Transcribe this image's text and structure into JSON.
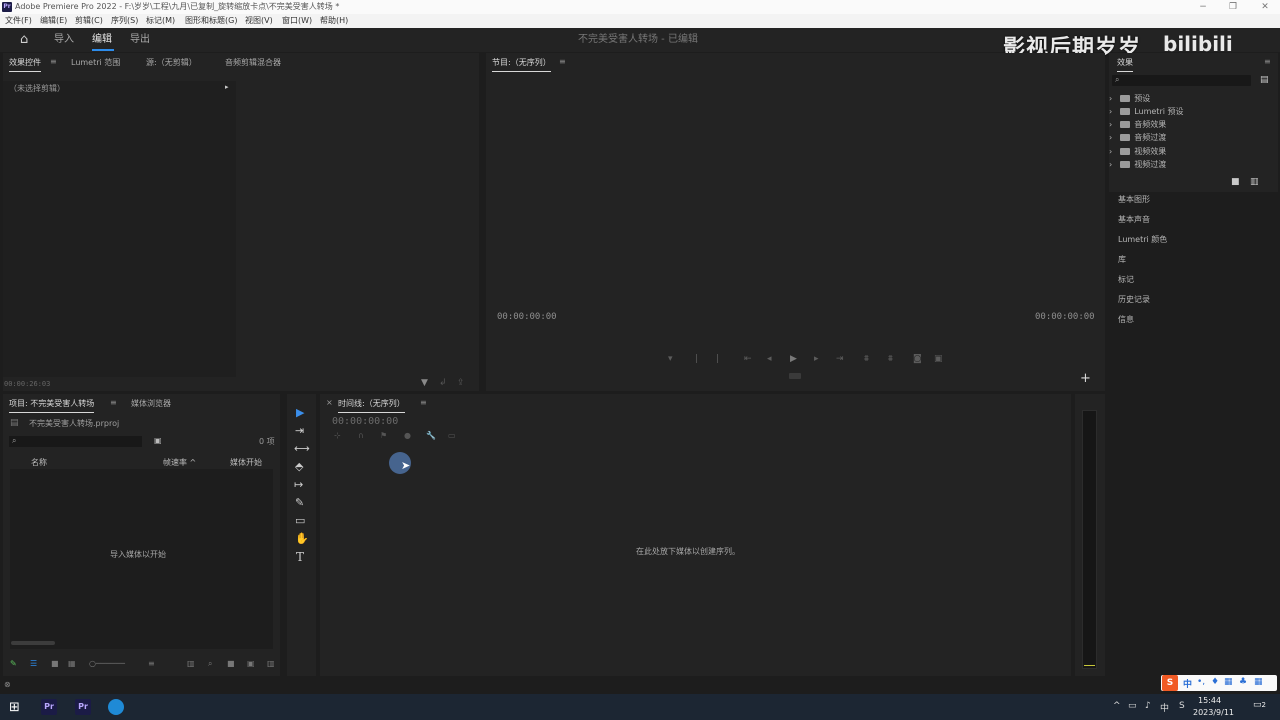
{
  "window": {
    "title": "Adobe Premiere Pro 2022 - F:\\岁岁\\工程\\九月\\已复制_旋转缩放卡点\\不完美受害人转场 *",
    "minimize": "−",
    "maximize": "❐",
    "close": "✕"
  },
  "menu": [
    "文件(F)",
    "编辑(E)",
    "剪辑(C)",
    "序列(S)",
    "标记(M)",
    "图形和标题(G)",
    "视图(V)",
    "窗口(W)",
    "帮助(H)"
  ],
  "header": {
    "home_icon": "⌂",
    "nav": [
      "导入",
      "编辑",
      "导出"
    ],
    "active_nav": "编辑",
    "project_status": "不完美受害人转场 - 已编辑"
  },
  "watermark": {
    "channel": "影视后期岁岁",
    "platform": "bilibili"
  },
  "effect_controls": {
    "tabs": [
      "效果控件",
      "Lumetri 范围",
      "源:（无剪辑）",
      "音频剪辑混合器"
    ],
    "menu_icon": "≡",
    "no_clip": "（未选择剪辑）",
    "timecode": "00:00:26:03"
  },
  "program": {
    "title": "节目:（无序列）",
    "menu_icon": "≡",
    "tc_left": "00:00:00:00",
    "tc_right": "00:00:00:00",
    "add_icon": "+"
  },
  "effects_panel": {
    "title": "效果",
    "menu_icon": "≡",
    "items": [
      "预设",
      "Lumetri 预设",
      "音频效果",
      "音频过渡",
      "视频效果",
      "视频过渡"
    ]
  },
  "side_sections": [
    "基本图形",
    "基本声音",
    "Lumetri 颜色",
    "库",
    "标记",
    "历史记录",
    "信息"
  ],
  "project": {
    "tabs": [
      "项目: 不完美受害人转场",
      "媒体浏览器"
    ],
    "menu_icon": "≡",
    "file": "不完美受害人转场.prproj",
    "item_count": "0 项",
    "columns": [
      "名称",
      "帧速率",
      "媒体开始"
    ],
    "empty_text": "导入媒体以开始"
  },
  "timeline": {
    "close": "×",
    "title": "时间线:（无序列）",
    "menu_icon": "≡",
    "timecode": "00:00:00:00",
    "drop_text": "在此处放下媒体以创建序列。"
  },
  "tools": [
    "▶",
    "⇥",
    "⟷",
    "⬘",
    "↦",
    "✎",
    "▭",
    "✋",
    "T"
  ],
  "taskbar": {
    "time": "15:44",
    "date": "2023/9/11",
    "lang": "中",
    "ime": "中",
    "notif": "2"
  }
}
